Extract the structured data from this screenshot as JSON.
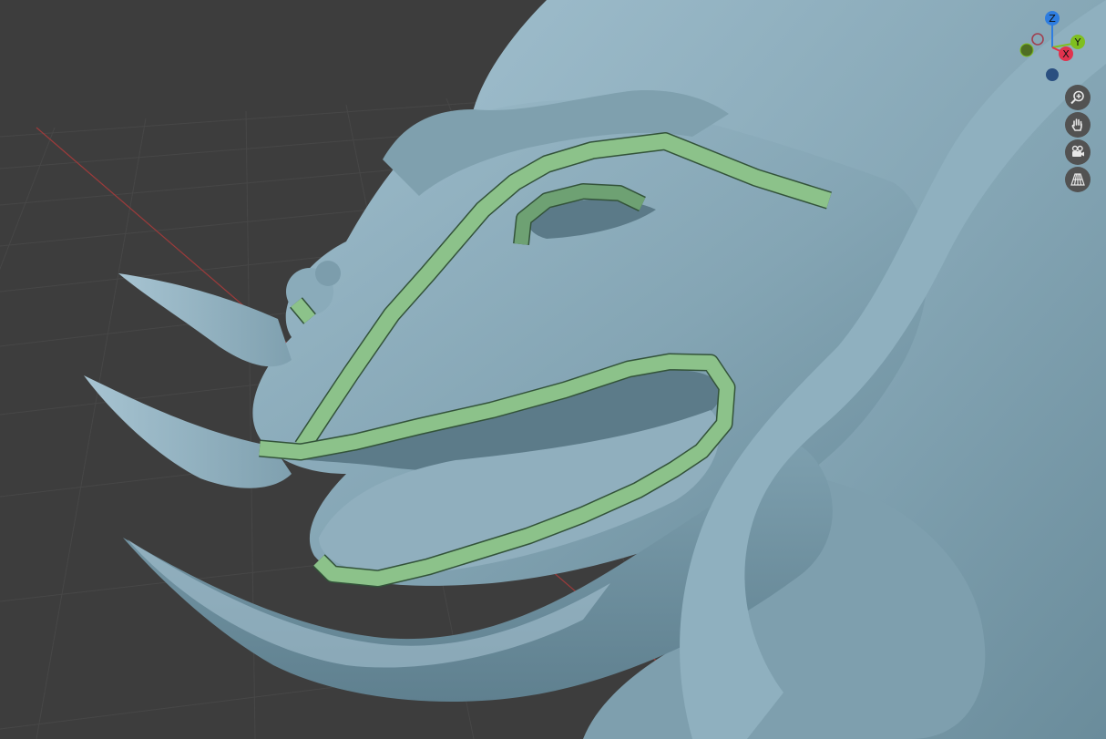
{
  "viewport": {
    "shading": "solid",
    "background_color": "#3d3d3d",
    "mesh_color": "#84a5b4",
    "annotation_strip_color": "#8cc28a"
  },
  "gizmo": {
    "axes": [
      {
        "label": "Z",
        "color": "#2e7de0"
      },
      {
        "label": "Y",
        "color": "#7fbf1f"
      },
      {
        "label": "X",
        "color": "#e0334e"
      }
    ]
  },
  "navigation": [
    {
      "icon": "zoom-icon"
    },
    {
      "icon": "hand-pan-icon"
    },
    {
      "icon": "camera-icon"
    },
    {
      "icon": "perspective-grid-icon"
    }
  ]
}
